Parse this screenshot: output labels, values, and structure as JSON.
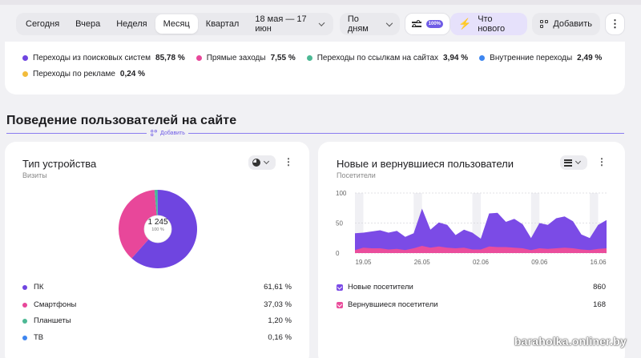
{
  "filters": {
    "periods": [
      {
        "label": "Сегодня",
        "active": false
      },
      {
        "label": "Вчера",
        "active": false
      },
      {
        "label": "Неделя",
        "active": false
      },
      {
        "label": "Месяц",
        "active": true
      },
      {
        "label": "Квартал",
        "active": false
      }
    ],
    "date_range": "18 мая — 17 июн",
    "grouping": "По дням",
    "sample_badge": "100%",
    "whats_new": "Что нового",
    "add": "Добавить"
  },
  "sources": [
    {
      "label": "Переходы из поисковых систем",
      "value": "85,78 %",
      "color": "#6f45e0"
    },
    {
      "label": "Прямые заходы",
      "value": "7,55 %",
      "color": "#e8479a"
    },
    {
      "label": "Переходы по ссылкам на сайтах",
      "value": "3,94 %",
      "color": "#4cb894"
    },
    {
      "label": "Внутренние переходы",
      "value": "2,49 %",
      "color": "#3e86f0"
    },
    {
      "label": "Переходы по рекламе",
      "value": "0,24 %",
      "color": "#f2bc3c"
    }
  ],
  "section": {
    "title": "Поведение пользователей на сайте",
    "add_label": "Добавить"
  },
  "device_card": {
    "title": "Тип устройства",
    "subtitle": "Визиты",
    "total": "1 245",
    "total_pct": "100 %",
    "chart_data": {
      "type": "pie",
      "categories": [
        "ПК",
        "Смартфоны",
        "Планшеты",
        "ТВ"
      ],
      "values": [
        61.61,
        37.03,
        1.2,
        0.16
      ],
      "colors": [
        "#6f45e0",
        "#e8479a",
        "#4cb894",
        "#3e86f0"
      ]
    },
    "rows": [
      {
        "label": "ПК",
        "value": "61,61 %",
        "color": "#6f45e0"
      },
      {
        "label": "Смартфоны",
        "value": "37,03 %",
        "color": "#e8479a"
      },
      {
        "label": "Планшеты",
        "value": "1,20 %",
        "color": "#4cb894"
      },
      {
        "label": "ТВ",
        "value": "0,16 %",
        "color": "#3e86f0"
      }
    ]
  },
  "visitors_card": {
    "title": "Новые и вернувшиеся пользователи",
    "subtitle": "Посетители",
    "chart_data": {
      "type": "area",
      "stacked": true,
      "ylim": [
        0,
        100
      ],
      "yticks": [
        0,
        50,
        100
      ],
      "x": [
        "18.05",
        "19.05",
        "20.05",
        "21.05",
        "22.05",
        "23.05",
        "24.05",
        "25.05",
        "26.05",
        "27.05",
        "28.05",
        "29.05",
        "30.05",
        "31.05",
        "01.06",
        "02.06",
        "03.06",
        "04.06",
        "05.06",
        "06.06",
        "07.06",
        "08.06",
        "09.06",
        "10.06",
        "11.06",
        "12.06",
        "13.06",
        "14.06",
        "15.06",
        "16.06",
        "17.06"
      ],
      "xticks": [
        "19.05",
        "26.05",
        "02.06",
        "09.06",
        "16.06"
      ],
      "weekend_bands": [
        [
          "18.05",
          "19.05"
        ],
        [
          "25.05",
          "26.05"
        ],
        [
          "01.06",
          "02.06"
        ],
        [
          "08.06",
          "09.06"
        ],
        [
          "15.06",
          "16.06"
        ]
      ],
      "series": [
        {
          "name": "Новые посетители",
          "color": "#7b4be6",
          "values": [
            28,
            25,
            28,
            30,
            28,
            30,
            22,
            25,
            62,
            30,
            40,
            38,
            22,
            30,
            28,
            18,
            55,
            57,
            42,
            48,
            40,
            20,
            42,
            40,
            50,
            52,
            45,
            25,
            20,
            40,
            47
          ]
        },
        {
          "name": "Вернувшиеся посетители",
          "color": "#ea4d9c",
          "values": [
            5,
            9,
            8,
            8,
            6,
            7,
            5,
            8,
            12,
            9,
            11,
            9,
            8,
            9,
            6,
            6,
            11,
            10,
            10,
            9,
            8,
            5,
            8,
            7,
            8,
            9,
            8,
            6,
            5,
            7,
            8
          ]
        }
      ]
    },
    "rows": [
      {
        "label": "Новые посетители",
        "value": "860",
        "color": "#7b4be6"
      },
      {
        "label": "Вернувшиеся посетители",
        "value": "168",
        "color": "#ea4d9c"
      }
    ]
  },
  "watermark": "baraholka.onliner.by"
}
